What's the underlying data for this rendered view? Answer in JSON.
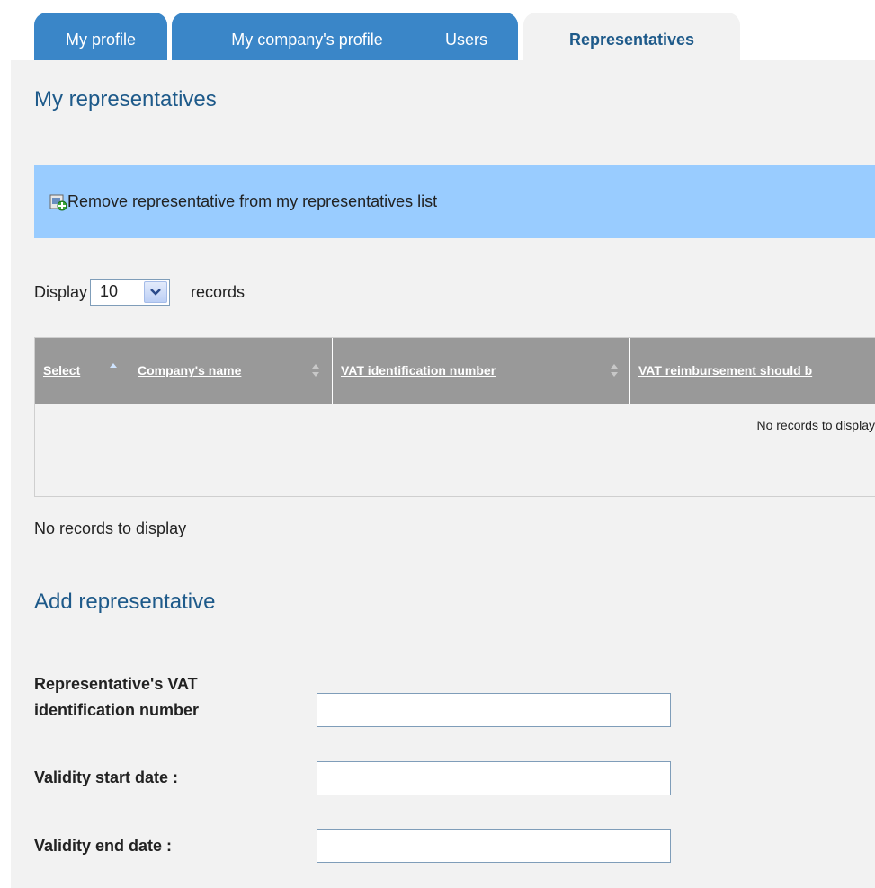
{
  "tabs": [
    {
      "label": "My profile",
      "active": false
    },
    {
      "label": "My company's profile",
      "active": false
    },
    {
      "label": "Users",
      "active": false
    },
    {
      "label": "Representatives",
      "active": true
    }
  ],
  "my_representatives": {
    "title": "My representatives",
    "remove_action_label": "Remove representative from my representatives list",
    "remove_action_icon": "document-add-icon",
    "display": {
      "prefix": "Display",
      "selected": "10",
      "suffix": "records"
    },
    "table": {
      "columns": [
        {
          "label": "Select",
          "sort": "ascending"
        },
        {
          "label": "Company's name",
          "sort": "none"
        },
        {
          "label": "VAT identification number",
          "sort": "none"
        },
        {
          "label": "VAT reimbursement should b",
          "sort": "none"
        }
      ],
      "empty_message": "No records to display"
    },
    "footer_message": "No records to display"
  },
  "add_representative": {
    "title": "Add representative",
    "fields": [
      {
        "label_line1": "Representative's VAT",
        "label_line2": "identification number",
        "value": ""
      },
      {
        "label": "Validity start date :",
        "value": ""
      },
      {
        "label": "Validity end date :",
        "value": ""
      }
    ]
  },
  "colors": {
    "tab_blue": "#3a86c8",
    "heading_blue": "#1e5a8a",
    "action_bar": "#99ccff",
    "table_header": "#999999",
    "panel": "#f2f2f2"
  }
}
